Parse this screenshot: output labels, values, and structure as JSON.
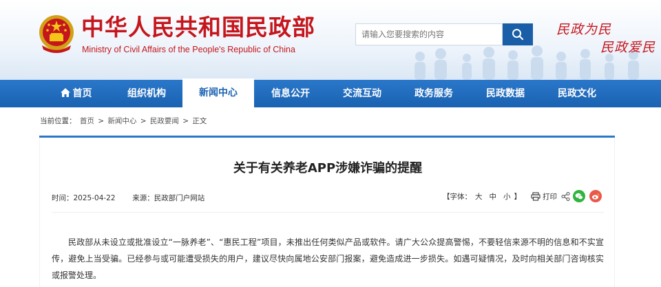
{
  "header": {
    "title": "中华人民共和国民政部",
    "subtitle": "Ministry of Civil Affairs of the People's Republic of China",
    "search_placeholder": "请输入您要搜索的内容",
    "slogan_line1": "民政为民",
    "slogan_line2": "民政爱民"
  },
  "nav": {
    "items": [
      {
        "label": "首页"
      },
      {
        "label": "组织机构"
      },
      {
        "label": "新闻中心"
      },
      {
        "label": "信息公开"
      },
      {
        "label": "交流互动"
      },
      {
        "label": "政务服务"
      },
      {
        "label": "民政数据"
      },
      {
        "label": "民政文化"
      }
    ],
    "active": "新闻中心"
  },
  "breadcrumb": {
    "prefix": "当前位置：",
    "items": [
      "首页",
      "新闻中心",
      "民政要闻",
      "正文"
    ],
    "separator": ">"
  },
  "article": {
    "title": "关于有关养老APP涉嫌诈骗的提醒",
    "time_label": "时间：",
    "time": "2025-04-22",
    "source_label": "来源：",
    "source": "民政部门户网站",
    "font_label_open": "【字体：",
    "font_sizes": [
      "大",
      "中",
      "小"
    ],
    "font_label_close": "】",
    "print_label": "打印",
    "body": "民政部从未设立或批准设立“一脉养老”、“惠民工程”项目，未推出任何类似产品或软件。请广大公众提高警惕，不要轻信来源不明的信息和不实宣传，避免上当受骗。已经参与或可能遭受损失的用户，建议尽快向属地公安部门报案，避免造成进一步损失。如遇可疑情况，及时向相关部门咨询核实或报警处理。"
  },
  "colors": {
    "brand_red": "#c4161c",
    "nav_blue": "#1a62b2",
    "wechat_green": "#2fb53c",
    "weibo_red": "#e8584b"
  },
  "icons": [
    "national-emblem-icon",
    "search-icon",
    "home-icon",
    "print-icon",
    "share-icon",
    "wechat-icon",
    "weibo-icon"
  ]
}
